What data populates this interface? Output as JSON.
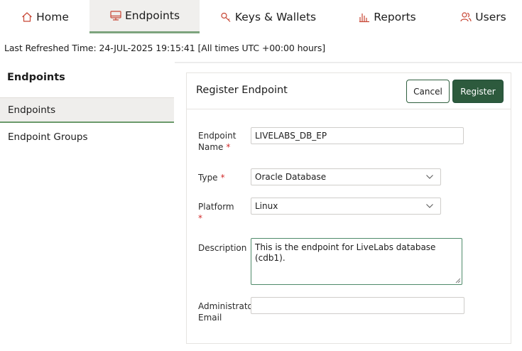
{
  "nav": {
    "tabs": [
      {
        "label": "Home",
        "icon": "home-icon",
        "active": false
      },
      {
        "label": "Endpoints",
        "icon": "endpoint-icon",
        "active": true
      },
      {
        "label": "Keys & Wallets",
        "icon": "key-icon",
        "active": false
      },
      {
        "label": "Reports",
        "icon": "chart-icon",
        "active": false
      },
      {
        "label": "Users",
        "icon": "users-icon",
        "active": false
      }
    ]
  },
  "refresh_text": "Last Refreshed Time: 24-JUL-2025 19:15:41 [All times UTC +00:00 hours]",
  "sidebar": {
    "title": "Endpoints",
    "items": [
      {
        "label": "Endpoints",
        "active": true
      },
      {
        "label": "Endpoint Groups",
        "active": false
      }
    ]
  },
  "form": {
    "title": "Register Endpoint",
    "cancel_label": "Cancel",
    "register_label": "Register",
    "required_mark": "*",
    "fields": {
      "endpoint_name": {
        "label_line1": "Endpoint",
        "label_line2": "Name",
        "value": "LIVELABS_DB_EP"
      },
      "type": {
        "label": "Type",
        "value": "Oracle Database"
      },
      "platform": {
        "label": "Platform",
        "value": "Linux"
      },
      "description": {
        "label": "Description",
        "value": "This is the endpoint for LiveLabs database (cdb1)."
      },
      "admin_email": {
        "label_line1": "Administrator",
        "label_line2": "Email",
        "value": ""
      }
    }
  },
  "colors": {
    "accent_green": "#2d5a3d",
    "active_underline": "#7da47d",
    "required_red": "#d12b2b",
    "icon_red": "#c74634"
  }
}
